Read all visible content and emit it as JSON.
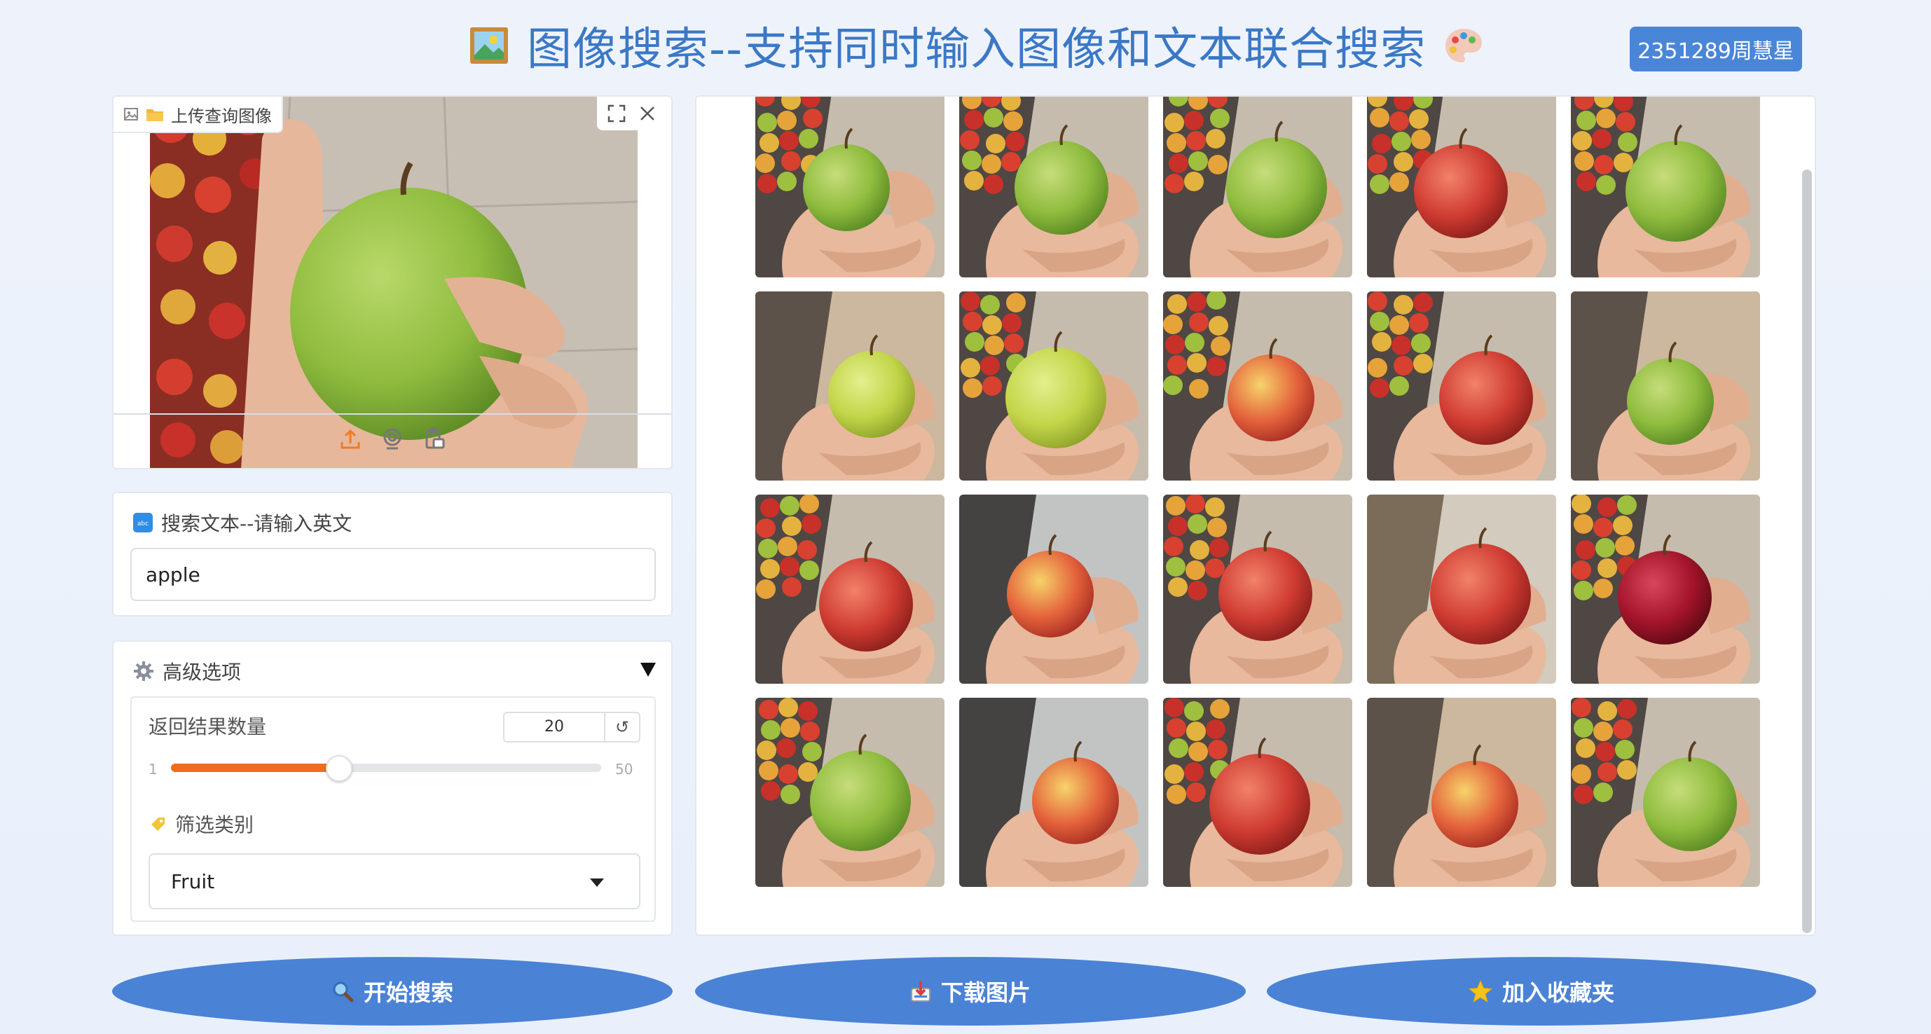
{
  "header": {
    "title": "图像搜索--支持同时输入图像和文本联合搜索",
    "user_badge": "2351289周慧星"
  },
  "query_image": {
    "tab_label": "上传查询图像",
    "image": "green-apple-in-hand"
  },
  "search_text": {
    "label": "搜索文本--请输入英文",
    "value": "apple"
  },
  "advanced": {
    "label": "高级选项",
    "result_count": {
      "label": "返回结果数量",
      "value": "20",
      "min": "1",
      "max": "50",
      "current": 20
    },
    "filter": {
      "label": "筛选类别",
      "value": "Fruit"
    }
  },
  "results": [
    {
      "apple": "green",
      "bg": "shelf"
    },
    {
      "apple": "green",
      "bg": "shelf"
    },
    {
      "apple": "green",
      "bg": "shelf"
    },
    {
      "apple": "red",
      "bg": "shelf"
    },
    {
      "apple": "green",
      "bg": "shelf"
    },
    {
      "apple": "yellowgreen",
      "bg": "floor"
    },
    {
      "apple": "yellowgreen",
      "bg": "shelf"
    },
    {
      "apple": "redyellow",
      "bg": "shelf"
    },
    {
      "apple": "red",
      "bg": "shelf"
    },
    {
      "apple": "green",
      "bg": "floor"
    },
    {
      "apple": "red",
      "bg": "shelf"
    },
    {
      "apple": "redyellow",
      "bg": "crate"
    },
    {
      "apple": "red",
      "bg": "shelf"
    },
    {
      "apple": "red",
      "bg": "store"
    },
    {
      "apple": "darkred",
      "bg": "shelf"
    },
    {
      "apple": "green",
      "bg": "shelf"
    },
    {
      "apple": "redyellow",
      "bg": "crate"
    },
    {
      "apple": "red",
      "bg": "shelf"
    },
    {
      "apple": "redyellow",
      "bg": "floor"
    },
    {
      "apple": "green",
      "bg": "shelf"
    }
  ],
  "buttons": {
    "search": "开始搜索",
    "download": "下载图片",
    "favorite": "加入收藏夹"
  },
  "colors": {
    "primary": "#4a82d6",
    "title": "#3b78c6",
    "slider": "#f26b1d"
  }
}
